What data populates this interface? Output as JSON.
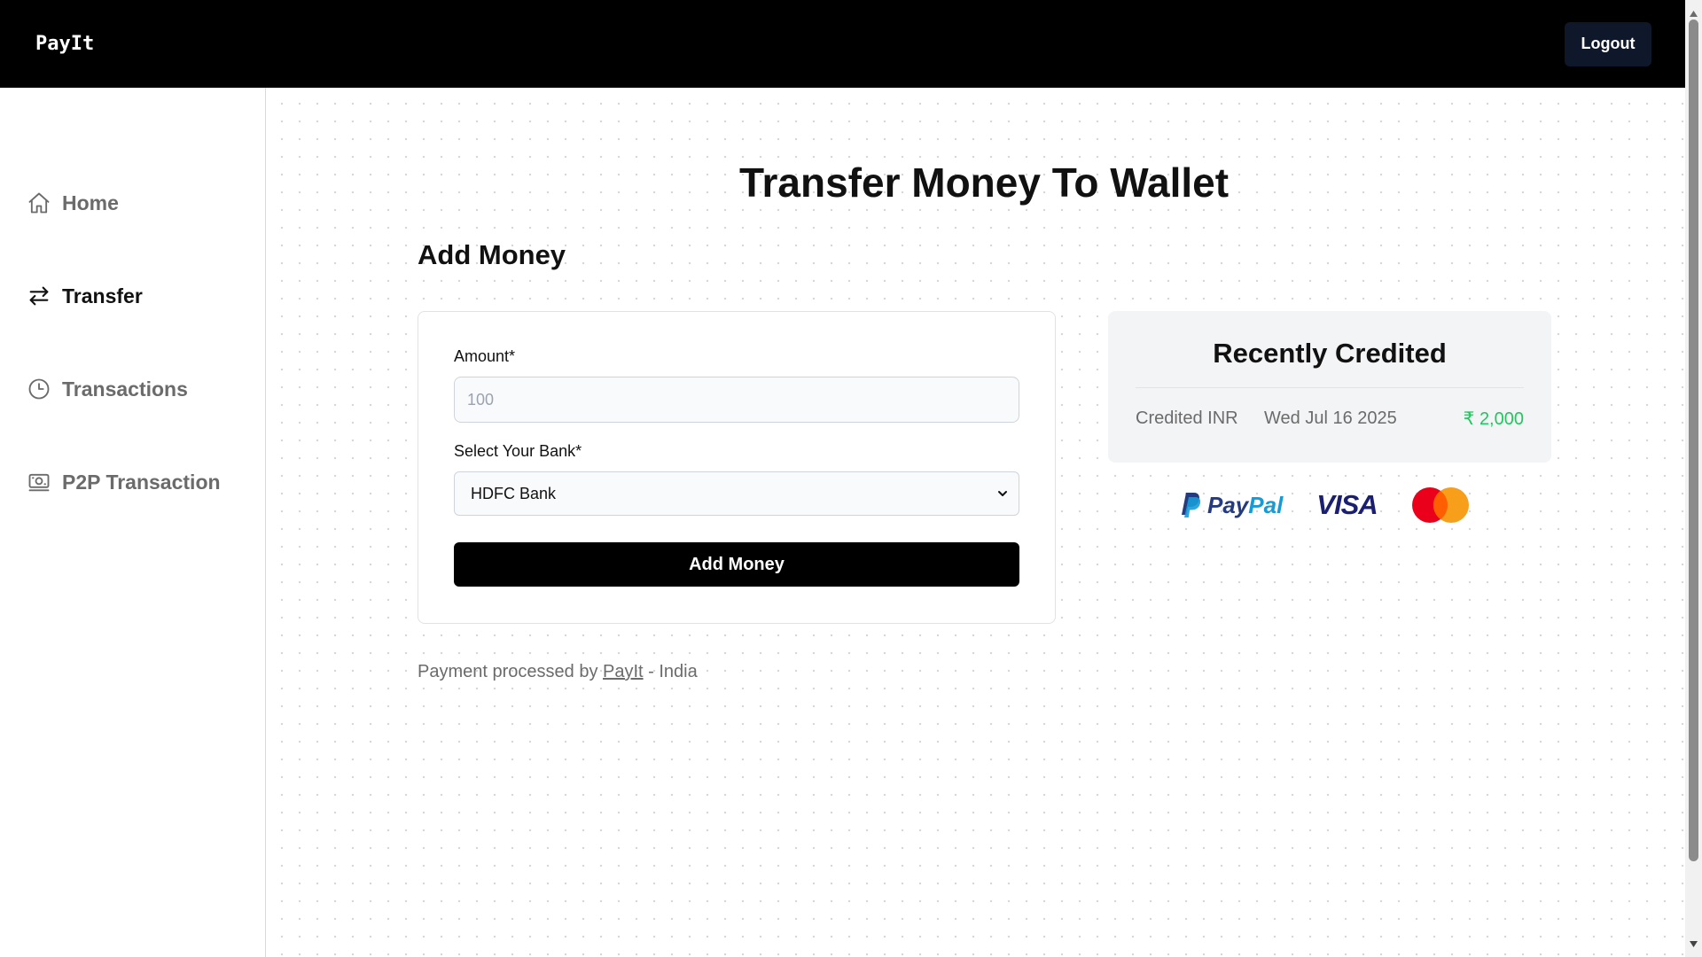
{
  "app": {
    "brand": "PayIt",
    "logout_label": "Logout"
  },
  "sidebar": {
    "items": [
      {
        "label": "Home",
        "icon": "home-icon",
        "active": false
      },
      {
        "label": "Transfer",
        "icon": "transfer-arrows-icon",
        "active": true
      },
      {
        "label": "Transactions",
        "icon": "clock-icon",
        "active": false
      },
      {
        "label": "P2P Transaction",
        "icon": "money-icon",
        "active": false
      }
    ]
  },
  "main": {
    "title": "Transfer Money To Wallet",
    "section_title": "Add Money",
    "form": {
      "amount_label": "Amount*",
      "amount_placeholder": "100",
      "bank_label": "Select Your Bank*",
      "bank_selected": "HDFC Bank",
      "submit_label": "Add Money"
    },
    "footer": {
      "prefix": "Payment processed by",
      "link": "PayIt",
      "suffix": "- India"
    },
    "recent": {
      "title": "Recently Credited",
      "entries": [
        {
          "label": "Credited INR",
          "date": "Wed Jul 16 2025",
          "amount": "₹ 2,000"
        }
      ]
    },
    "payment_logos": {
      "paypal_pay": "Pay",
      "paypal_pal": "Pal",
      "visa": "VISA"
    }
  },
  "colors": {
    "topbar": "#000000",
    "credit_amount": "#22c55e",
    "paypal_dark": "#253b80",
    "paypal_light": "#179bd7",
    "visa": "#1a1f71",
    "mastercard_red": "#eb001b",
    "mastercard_orange": "#f79e1b"
  }
}
